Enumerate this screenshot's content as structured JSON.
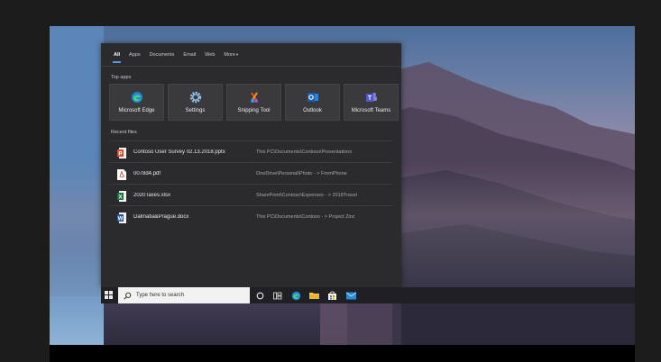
{
  "search": {
    "tabs": [
      {
        "label": "All",
        "active": true
      },
      {
        "label": "Apps"
      },
      {
        "label": "Documents"
      },
      {
        "label": "Email"
      },
      {
        "label": "Web"
      },
      {
        "label": "More",
        "icon": "chevron-down-icon"
      }
    ],
    "top_apps_label": "Top apps",
    "top_apps": [
      {
        "label": "Microsoft Edge",
        "icon": "edge-icon"
      },
      {
        "label": "Settings",
        "icon": "gear-icon"
      },
      {
        "label": "Snipping Tool",
        "icon": "scissors-icon"
      },
      {
        "label": "Outlook",
        "icon": "outlook-icon"
      },
      {
        "label": "Microsoft Teams",
        "icon": "teams-icon"
      }
    ],
    "recent_label": "Recent files",
    "recent_files": [
      {
        "name": "Contoso User Survey 02.13.2018.pptx",
        "path": "This PC\\Documents\\Contoso\\Presentations",
        "icon": "powerpoint-icon"
      },
      {
        "name": "0078d4.pdf",
        "path": "OneDrive\\Personal\\Photo - > FromPhone",
        "icon": "pdf-icon"
      },
      {
        "name": "2020Taxes.xlsx",
        "path": "SharePoint\\Contoso\\Expenses - > 2018Travel",
        "icon": "excel-icon"
      },
      {
        "name": "Dalmatia&Prague.docx",
        "path": "This PC\\Documents\\Contoso - > Project Zinc",
        "icon": "word-icon"
      }
    ]
  },
  "taskbar": {
    "search_placeholder": "Type here to search",
    "icons": [
      "start-icon",
      "search-icon",
      "cortana-icon",
      "task-view-icon",
      "edge-icon",
      "file-explorer-icon",
      "store-icon",
      "mail-icon"
    ]
  },
  "colors": {
    "accent": "#4f9ce8",
    "panel": "#2b2b2d",
    "taskbar": "#202024"
  }
}
